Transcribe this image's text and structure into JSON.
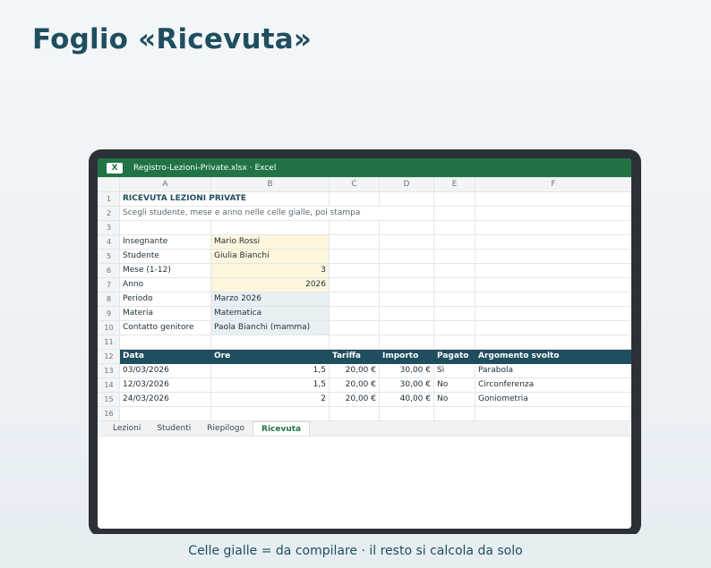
{
  "page": {
    "title": "Foglio «Ricevuta»"
  },
  "window": {
    "app_icon": "X",
    "title": "Registro-Lezioni-Private.xlsx · Excel"
  },
  "columns": [
    "A",
    "B",
    "C",
    "D",
    "E",
    "F"
  ],
  "rows": {
    "r1": {
      "num": "1",
      "a": "RICEVUTA LEZIONI PRIVATE"
    },
    "r2": {
      "num": "2",
      "a": "Scegli studente, mese e anno nelle celle gialle, poi stampa"
    },
    "r3": {
      "num": "3"
    },
    "r4": {
      "num": "4",
      "a": "Insegnante",
      "b": "Mario Rossi"
    },
    "r5": {
      "num": "5",
      "a": "Studente",
      "b": "Giulia Bianchi"
    },
    "r6": {
      "num": "6",
      "a": "Mese (1-12)",
      "b": "3"
    },
    "r7": {
      "num": "7",
      "a": "Anno",
      "b": "2026"
    },
    "r8": {
      "num": "8",
      "a": "Periodo",
      "b": "Marzo 2026"
    },
    "r9": {
      "num": "9",
      "a": "Materia",
      "b": "Matematica"
    },
    "r10": {
      "num": "10",
      "a": "Contatto genitore",
      "b": "Paola Bianchi (mamma)"
    },
    "r11": {
      "num": "11"
    },
    "r12": {
      "num": "12",
      "a": "Data",
      "b": "Ore",
      "c": "Tariffa",
      "d": "Importo",
      "e": "Pagato",
      "f": "Argomento svolto"
    },
    "r13": {
      "num": "13",
      "a": "03/03/2026",
      "b": "1,5",
      "c": "20,00 €",
      "d": "30,00 €",
      "e": "Sì",
      "f": "Parabola"
    },
    "r14": {
      "num": "14",
      "a": "12/03/2026",
      "b": "1,5",
      "c": "20,00 €",
      "d": "30,00 €",
      "e": "No",
      "f": "Circonferenza"
    },
    "r15": {
      "num": "15",
      "a": "24/03/2026",
      "b": "2",
      "c": "20,00 €",
      "d": "40,00 €",
      "e": "No",
      "f": "Goniometria"
    },
    "r16": {
      "num": "16"
    }
  },
  "sheet_tabs": [
    "Lezioni",
    "Studenti",
    "Riepilogo",
    "Ricevuta"
  ],
  "active_tab": "Ricevuta",
  "footer": "Celle gialle = da compilare · il resto si calcola da solo"
}
